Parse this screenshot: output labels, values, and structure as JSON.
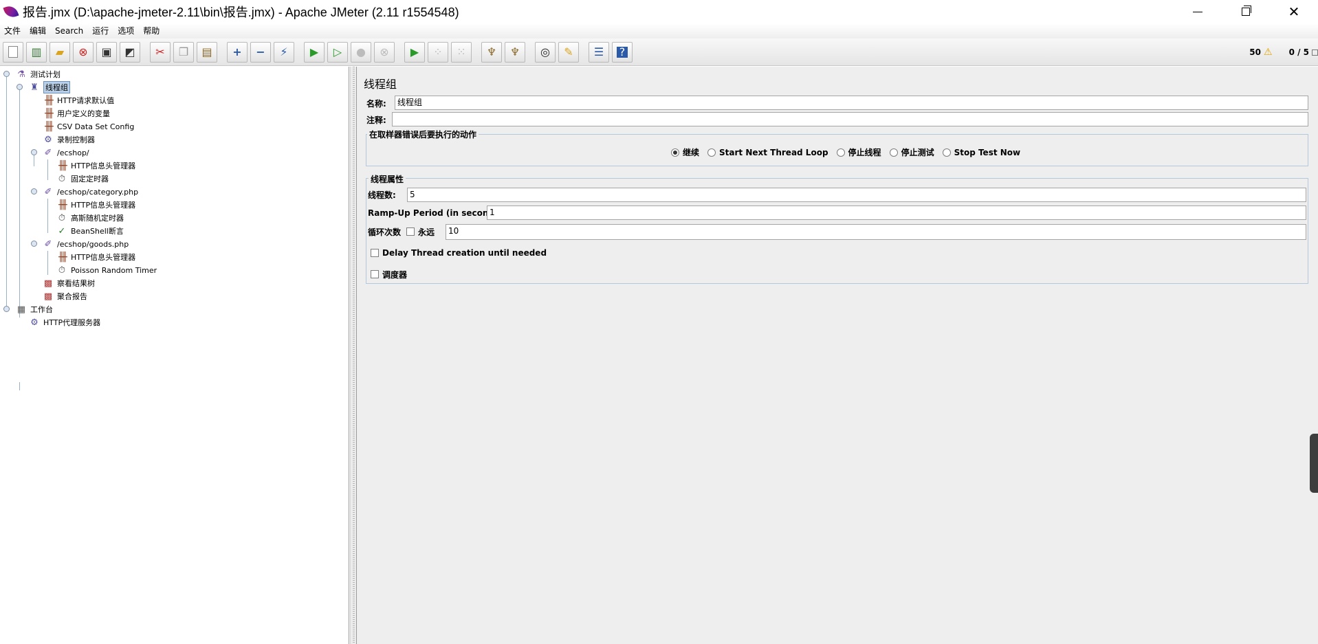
{
  "window": {
    "title": "报告.jmx (D:\\apache-jmeter-2.11\\bin\\报告.jmx) - Apache JMeter (2.11 r1554548)"
  },
  "menu": [
    "文件",
    "编辑",
    "Search",
    "运行",
    "选项",
    "帮助"
  ],
  "toolbar": {
    "buttons": [
      {
        "name": "new",
        "icon": "new-file-icon"
      },
      {
        "name": "templates",
        "icon": "templates-icon"
      },
      {
        "name": "open",
        "icon": "open-folder-icon"
      },
      {
        "name": "close",
        "icon": "close-file-icon"
      },
      {
        "name": "save",
        "icon": "save-icon"
      },
      {
        "name": "save-as-image",
        "icon": "save-image-icon"
      },
      {
        "name": "cut",
        "icon": "cut-icon"
      },
      {
        "name": "copy",
        "icon": "copy-icon"
      },
      {
        "name": "paste",
        "icon": "paste-icon"
      },
      {
        "name": "expand-all",
        "icon": "plus-icon"
      },
      {
        "name": "collapse-all",
        "icon": "minus-icon"
      },
      {
        "name": "toggle",
        "icon": "toggle-icon"
      },
      {
        "name": "start",
        "icon": "play-icon"
      },
      {
        "name": "start-no-pauses",
        "icon": "play-no-pause-icon"
      },
      {
        "name": "stop",
        "icon": "stop-icon"
      },
      {
        "name": "shutdown",
        "icon": "shutdown-icon"
      },
      {
        "name": "remote-start-all",
        "icon": "remote-start-icon"
      },
      {
        "name": "remote-stop-all",
        "icon": "remote-stop-icon"
      },
      {
        "name": "remote-shutdown-all",
        "icon": "remote-shutdown-icon"
      },
      {
        "name": "clear",
        "icon": "broom-icon"
      },
      {
        "name": "clear-all",
        "icon": "broom-all-icon"
      },
      {
        "name": "search",
        "icon": "binoculars-icon"
      },
      {
        "name": "reset-search",
        "icon": "reset-search-icon"
      },
      {
        "name": "function-helper",
        "icon": "function-helper-icon"
      },
      {
        "name": "help",
        "icon": "help-icon"
      }
    ],
    "warning_count": "50",
    "threads": "0 / 5"
  },
  "tree": {
    "nodes": [
      {
        "label": "测试计划",
        "icon": "test-plan-icon",
        "depth": 0,
        "selected": false
      },
      {
        "label": "线程组",
        "icon": "thread-group-icon",
        "depth": 1,
        "selected": true
      },
      {
        "label": "HTTP请求默认值",
        "icon": "config-element-icon",
        "depth": 2,
        "selected": false
      },
      {
        "label": "用户定义的变量",
        "icon": "config-element-icon",
        "depth": 2,
        "selected": false
      },
      {
        "label": "CSV Data Set Config",
        "icon": "config-element-icon",
        "depth": 2,
        "selected": false
      },
      {
        "label": "录制控制器",
        "icon": "controller-icon",
        "depth": 2,
        "selected": false
      },
      {
        "label": "/ecshop/",
        "icon": "sampler-icon",
        "depth": 2,
        "selected": false
      },
      {
        "label": "HTTP信息头管理器",
        "icon": "config-element-icon",
        "depth": 3,
        "selected": false
      },
      {
        "label": "固定定时器",
        "icon": "timer-icon",
        "depth": 3,
        "selected": false
      },
      {
        "label": "/ecshop/category.php",
        "icon": "sampler-icon",
        "depth": 2,
        "selected": false
      },
      {
        "label": "HTTP信息头管理器",
        "icon": "config-element-icon",
        "depth": 3,
        "selected": false
      },
      {
        "label": "高斯随机定时器",
        "icon": "timer-icon",
        "depth": 3,
        "selected": false
      },
      {
        "label": "BeanShell断言",
        "icon": "assertion-icon",
        "depth": 3,
        "selected": false
      },
      {
        "label": "/ecshop/goods.php",
        "icon": "sampler-icon",
        "depth": 2,
        "selected": false
      },
      {
        "label": "HTTP信息头管理器",
        "icon": "config-element-icon",
        "depth": 3,
        "selected": false
      },
      {
        "label": "Poisson Random Timer",
        "icon": "timer-icon",
        "depth": 3,
        "selected": false
      },
      {
        "label": "察看结果树",
        "icon": "listener-icon",
        "depth": 2,
        "selected": false
      },
      {
        "label": "聚合报告",
        "icon": "listener-icon",
        "depth": 2,
        "selected": false
      },
      {
        "label": "工作台",
        "icon": "workbench-icon",
        "depth": 0,
        "selected": false
      },
      {
        "label": "HTTP代理服务器",
        "icon": "controller-icon",
        "depth": 1,
        "selected": false
      }
    ]
  },
  "panel": {
    "title": "线程组",
    "name_label": "名称:",
    "name_value": "线程组",
    "comment_label": "注释:",
    "comment_value": "",
    "error_action": {
      "title": "在取样器错误后要执行的动作",
      "options": [
        {
          "label": "继续",
          "checked": true
        },
        {
          "label": "Start Next Thread Loop",
          "checked": false
        },
        {
          "label": "停止线程",
          "checked": false
        },
        {
          "label": "停止测试",
          "checked": false
        },
        {
          "label": "Stop Test Now",
          "checked": false
        }
      ]
    },
    "thread_props": {
      "title": "线程属性",
      "threads_label": "线程数:",
      "threads_value": "5",
      "rampup_label": "Ramp-Up Period (in seconds):",
      "rampup_value": "1",
      "loop_label": "循环次数",
      "forever_label": "永远",
      "forever_checked": false,
      "loop_value": "10",
      "delay_label": "Delay Thread creation until needed",
      "delay_checked": false,
      "scheduler_label": "调度器",
      "scheduler_checked": false
    }
  }
}
